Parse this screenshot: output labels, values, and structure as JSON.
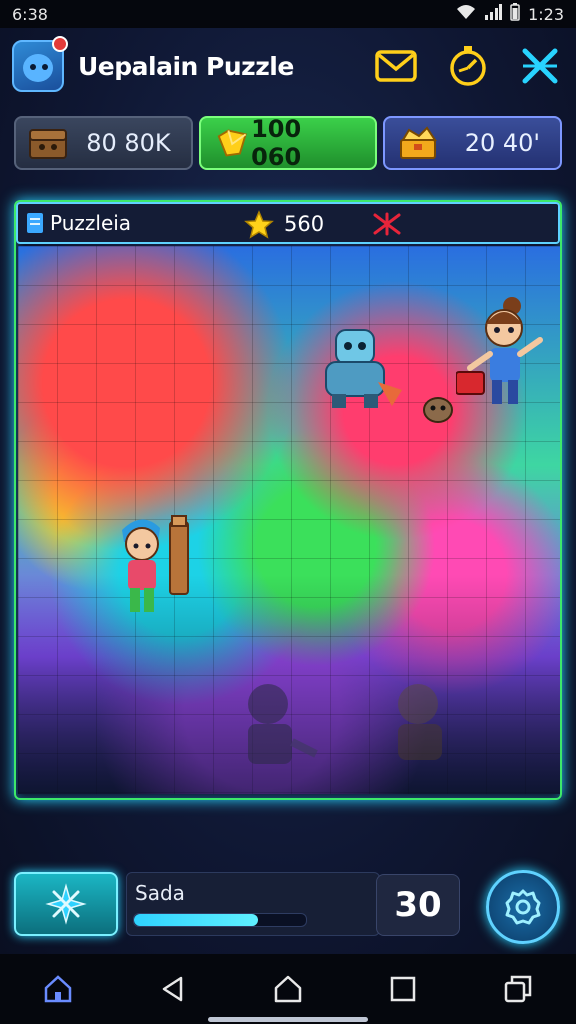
{
  "status_bar": {
    "time_left": "6:38",
    "time_right": "1:23"
  },
  "header": {
    "title": "Uepalain Puzzle"
  },
  "currency": [
    {
      "value": "80 80K",
      "icon": "chest-icon"
    },
    {
      "value": "100 060",
      "icon": "gem-icon"
    },
    {
      "value": "20 40'",
      "icon": "treasure-icon"
    }
  ],
  "board": {
    "label": "Puzzleia",
    "score": "560"
  },
  "bottom": {
    "progress_label": "Sada",
    "progress_fraction": 0.72,
    "counter": "30"
  },
  "colors": {
    "accent_cyan": "#28d3ff",
    "accent_green": "#3ee86a",
    "accent_yellow": "#ffcf1a",
    "bg": "#0f1733"
  }
}
